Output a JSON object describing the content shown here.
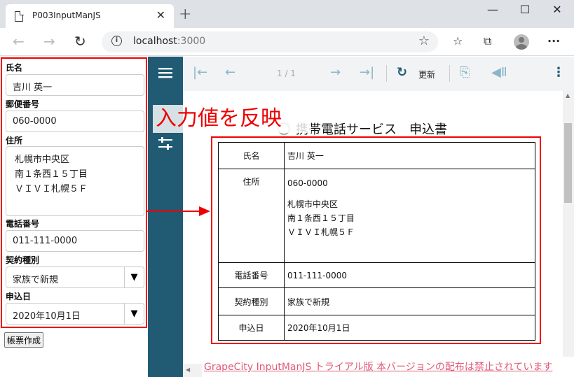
{
  "browser": {
    "tab_title": "P003InputManJS",
    "url_host": "localhost",
    "url_port": ":3000"
  },
  "form": {
    "fields": [
      {
        "label": "氏名",
        "value": "吉川 英一"
      },
      {
        "label": "郵便番号",
        "value": "060-0000"
      },
      {
        "label": "住所",
        "lines": [
          "札幌市中央区",
          "南１条西１５丁目",
          "ＶＩＶＩ札幌５Ｆ"
        ]
      },
      {
        "label": "電話番号",
        "value": "011-111-0000"
      },
      {
        "label": "契約種別",
        "value": "家族で新規"
      },
      {
        "label": "申込日",
        "value": "2020年10月1日"
      }
    ],
    "generate_button": "帳票作成"
  },
  "viewer": {
    "page_indicator": "1 / 1",
    "refresh_label": "更新",
    "overlay_caption": "入力値を反映",
    "doc_title": "携帯電話サービス　申込書",
    "table": {
      "rows": [
        {
          "key": "氏名",
          "value": "吉川 英一"
        },
        {
          "key": "住所",
          "lines": [
            "060-0000",
            "",
            "札幌市中央区",
            "南１条西１５丁目",
            "ＶＩＶＩ札幌５Ｆ"
          ]
        },
        {
          "key": "電話番号",
          "value": "011-111-0000"
        },
        {
          "key": "契約種別",
          "value": "家族で新規"
        },
        {
          "key": "申込日",
          "value": "2020年10月1日"
        }
      ]
    }
  },
  "trial_banner": "GrapeCity InputManJS トライアル版 本バージョンの配布は禁止されています",
  "colors": {
    "accent_red": "#e00000",
    "viewer_sidebar": "#205a73",
    "trial_link": "#e05a78"
  }
}
